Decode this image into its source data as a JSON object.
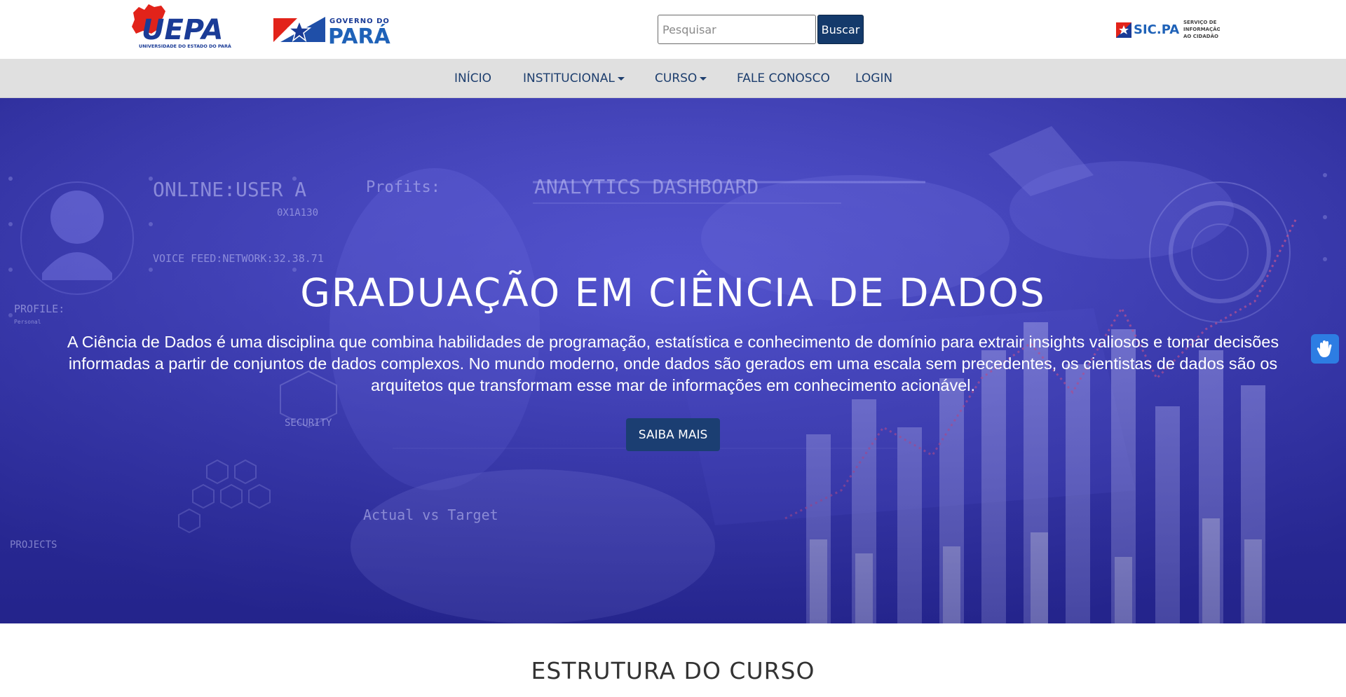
{
  "header": {
    "uepa_logo": {
      "wordmark": "UEPA",
      "subtitle": "UNIVERSIDADE DO ESTADO DO PARÁ"
    },
    "gov_logo": {
      "line1": "GOVERNO DO",
      "line2": "PARÁ"
    },
    "search": {
      "placeholder": "Pesquisar",
      "value": "",
      "button_label": "Buscar"
    },
    "sic_logo": {
      "wordmark": "SIC.PA",
      "line1": "SERVIÇO DE",
      "line2": "INFORMAÇÃO",
      "line3": "AO CIDADÃO"
    }
  },
  "nav": {
    "items": [
      {
        "label": "INÍCIO",
        "dropdown": false
      },
      {
        "label": "INSTITUCIONAL",
        "dropdown": true
      },
      {
        "label": "CURSO",
        "dropdown": true
      },
      {
        "label": "FALE CONOSCO",
        "dropdown": false
      },
      {
        "label": "LOGIN",
        "dropdown": false
      }
    ]
  },
  "hero": {
    "title": "GRADUAÇÃO EM CIÊNCIA DE DADOS",
    "description": "A Ciência de Dados é uma disciplina que combina habilidades de programação, estatística e conhecimento de domínio para extrair insights valiosos e tomar decisões informadas a partir de conjuntos de dados complexos. No mundo moderno, onde dados são gerados em uma escala sem precedentes, os cientistas de dados são os arquitetos que transformam esse mar de informações em conhecimento acionável.",
    "button_label": "SAIBA MAIS",
    "background_texts": {
      "online_user": "ONLINE:USER A",
      "user_id": "0X1A130",
      "profits": "Profits:",
      "dashboard": "ANALYTICS DASHBOARD",
      "voice_feed": "VOICE FEED:NETWORK:32.38.71",
      "profile": "PROFILE:",
      "profile_sub": "Personal",
      "security": "SECURITY",
      "actual_vs_target": "Actual vs Target",
      "projects": "PROJECTS"
    }
  },
  "section": {
    "title": "ESTRUTURA DO CURSO"
  },
  "colors": {
    "brand_navy": "#143a6b",
    "nav_text": "#1d3e6e",
    "nav_bg": "#e0e0e0",
    "hero_overlay": "#3c3cb4",
    "uepa_red": "#e2231a",
    "uepa_blue": "#1a3b96",
    "accessibility_blue": "#2d7de3"
  },
  "icons": {
    "accessibility": "hand-sign-language-icon",
    "dropdown": "caret-down-icon"
  }
}
